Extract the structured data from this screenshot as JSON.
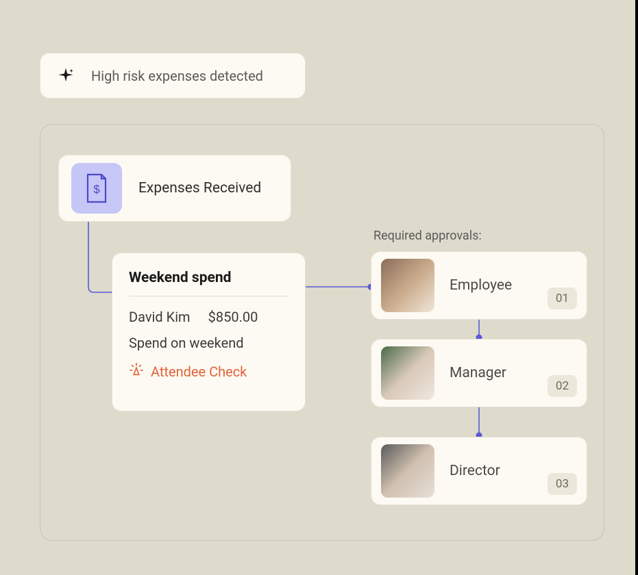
{
  "alert": {
    "text": "High risk expenses detected",
    "icon": "sparkle-icon"
  },
  "received": {
    "label": "Expenses Received",
    "icon": "document-dollar-icon"
  },
  "spend": {
    "title": "Weekend spend",
    "person": "David Kim",
    "amount": "$850.00",
    "note": "Spend on weekend",
    "flag": "Attendee Check",
    "flag_icon": "alert-burst-icon",
    "flag_color": "#e2633b"
  },
  "approvals": {
    "label": "Required approvals:",
    "items": [
      {
        "role": "Employee",
        "badge": "01"
      },
      {
        "role": "Manager",
        "badge": "02"
      },
      {
        "role": "Director",
        "badge": "03"
      }
    ]
  },
  "colors": {
    "bg": "#dedacc",
    "card": "#fcfaf2",
    "tile": "#c6c6f7",
    "line": "#5a5ad4"
  }
}
